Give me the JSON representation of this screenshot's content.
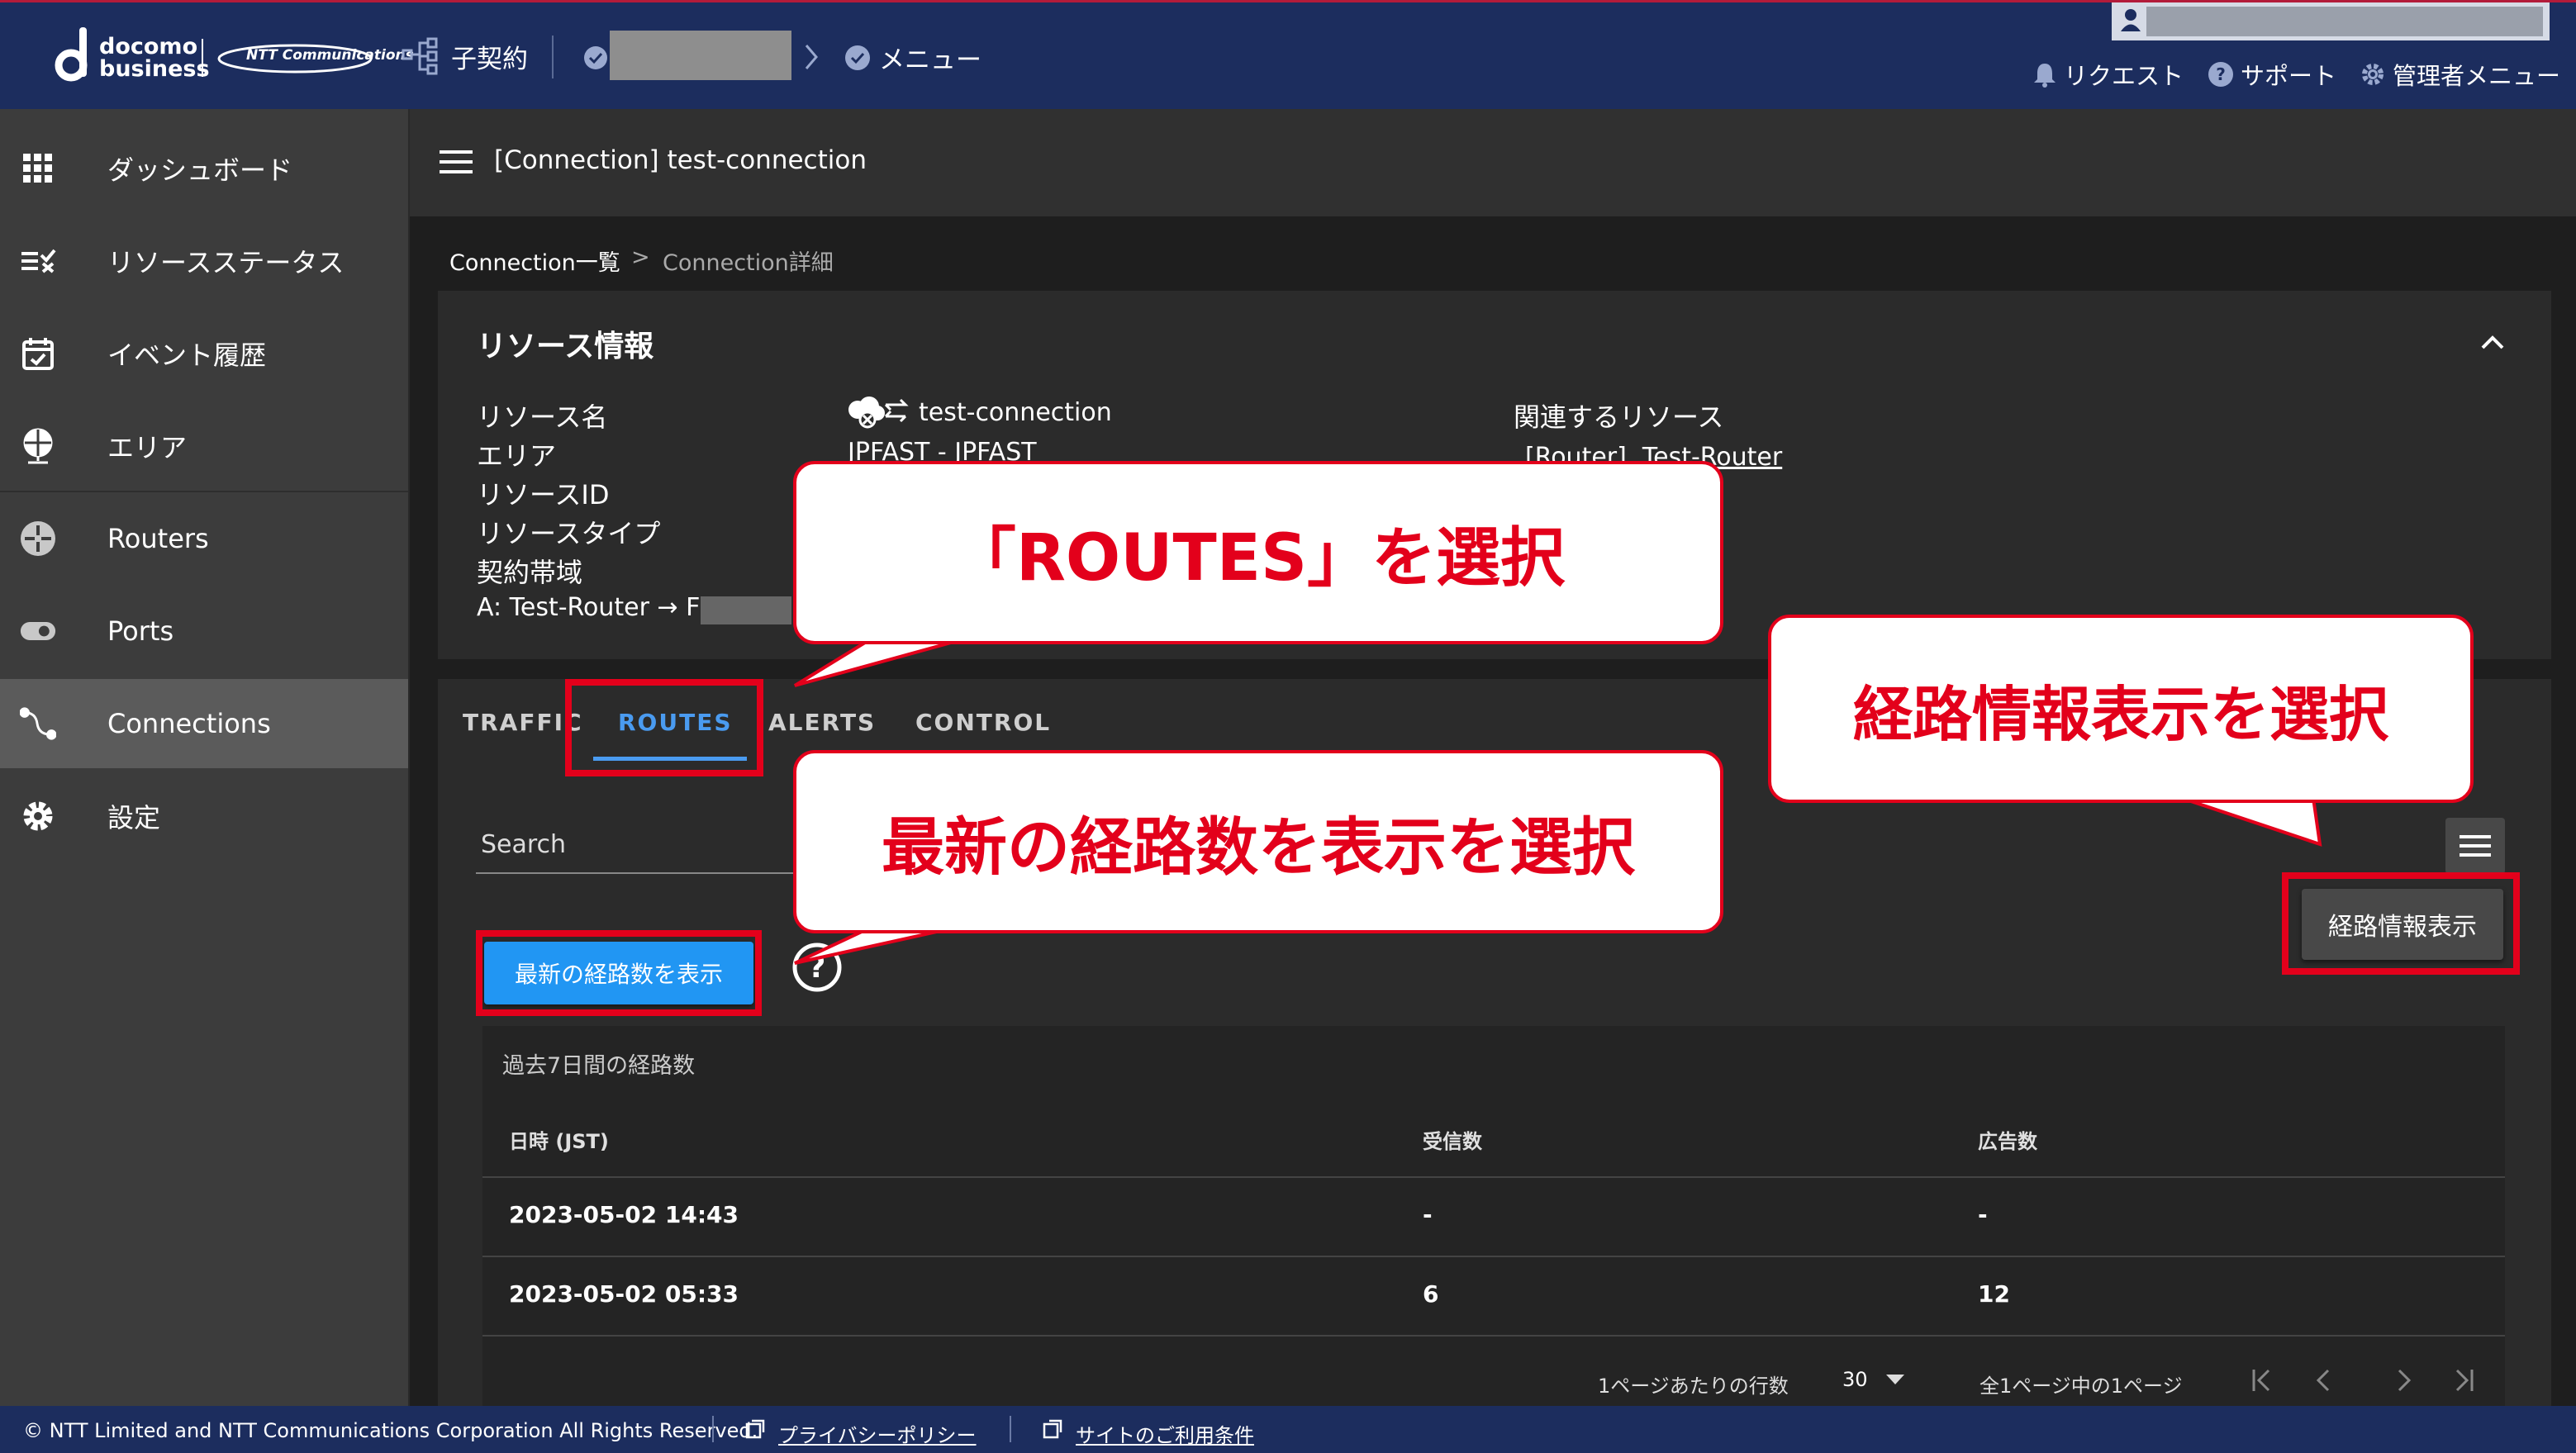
{
  "header": {
    "logo_line1": "docomo",
    "logo_line2": "business",
    "ntt_logo": "NTT Communications",
    "sub_contract": "子契約",
    "menu": "メニュー",
    "request": "リクエスト",
    "support": "サポート",
    "admin_menu": "管理者メニュー"
  },
  "sidebar": {
    "items": [
      {
        "label": "ダッシュボード",
        "icon": "grid-icon"
      },
      {
        "label": "リソースステータス",
        "icon": "checklist-icon"
      },
      {
        "label": "イベント履歴",
        "icon": "calendar-check-icon"
      },
      {
        "label": "エリア",
        "icon": "globe-pin-icon"
      },
      {
        "label": "Routers",
        "icon": "router-icon"
      },
      {
        "label": "Ports",
        "icon": "port-icon"
      },
      {
        "label": "Connections",
        "icon": "connection-icon"
      },
      {
        "label": "設定",
        "icon": "gear-icon"
      }
    ],
    "active": "Connections"
  },
  "title": "[Connection] test-connection",
  "breadcrumb": {
    "parent": "Connection一覧",
    "sep": ">",
    "current": "Connection詳細"
  },
  "resource": {
    "heading": "リソース情報",
    "labels": {
      "name": "リソース名",
      "area": "エリア",
      "id": "リソースID",
      "type": "リソースタイプ",
      "bandwidth": "契約帯域",
      "endpoints": "A: Test-Router → F"
    },
    "name_value": "test-connection",
    "area_value": "JPFAST - JPFAST",
    "related_label": "関連するリソース",
    "related_value": "[Router]  Test-Router"
  },
  "tabs": [
    "TRAFFIC",
    "ROUTES",
    "ALERTS",
    "CONTROL"
  ],
  "active_tab": "ROUTES",
  "routes": {
    "search_label": "Search",
    "show_latest_button": "最新の経路数を表示",
    "show_route_info_button": "経路情報表示",
    "panel_title": "過去7日間の経路数",
    "columns": [
      "日時 (JST)",
      "受信数",
      "広告数"
    ],
    "rows": [
      {
        "time": "2023-05-02 14:43",
        "received": "-",
        "advertised": "-"
      },
      {
        "time": "2023-05-02 05:33",
        "received": "6",
        "advertised": "12"
      }
    ],
    "pagination": {
      "rows_per_page_label": "1ページあたりの行数",
      "rows_per_page": "30",
      "page_info": "全1ページ中の1ページ"
    }
  },
  "footer": {
    "copyright": "© NTT Limited and NTT Communications Corporation All Rights Reserved.",
    "privacy": "プライバシーポリシー",
    "terms": "サイトのご利用条件"
  },
  "annotations": {
    "routes_callout": "「ROUTES」を選択",
    "route_info_callout": "経路情報表示を選択",
    "latest_callout": "最新の経路数を表示を選択"
  },
  "colors": {
    "header": "#1c2d5e",
    "accent": "#4a9bf0",
    "button_blue": "#2196f3",
    "annotation_red": "#e3001b"
  }
}
